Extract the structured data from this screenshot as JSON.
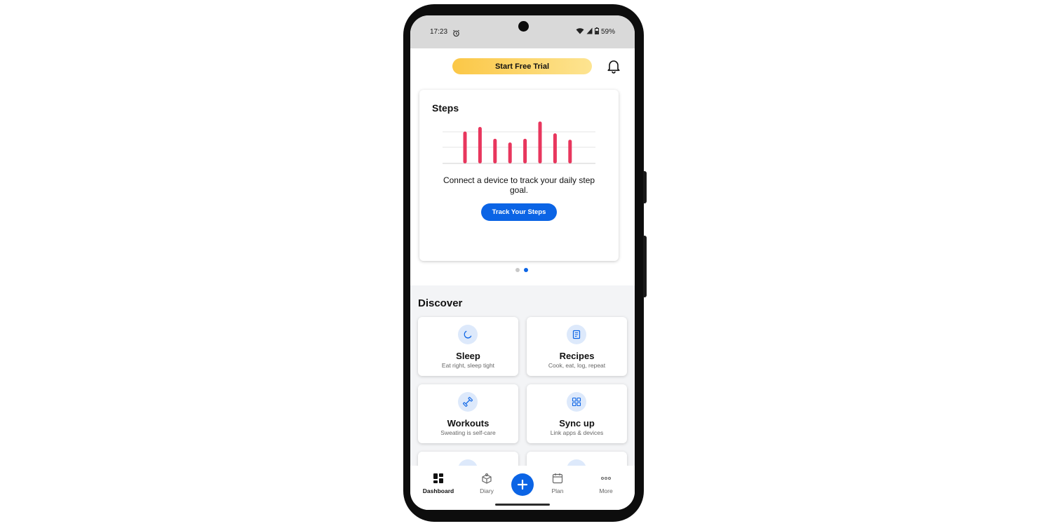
{
  "status": {
    "time": "17:23",
    "battery": "59%"
  },
  "topbar": {
    "trial_label": "Start Free Trial"
  },
  "steps_card": {
    "title": "Steps",
    "message": "Connect a device to track your daily step goal.",
    "button_label": "Track Your Steps",
    "bar_levels": [
      0.7,
      0.8,
      0.54,
      0.46,
      0.54,
      0.92,
      0.66,
      0.52
    ],
    "bar_color": "#e8365d"
  },
  "carousel": {
    "count": 2,
    "active_index": 1
  },
  "discover": {
    "title": "Discover",
    "tiles": [
      {
        "title": "Sleep",
        "subtitle": "Eat right, sleep tight",
        "icon": "moon-icon"
      },
      {
        "title": "Recipes",
        "subtitle": "Cook, eat, log, repeat",
        "icon": "recipe-icon"
      },
      {
        "title": "Workouts",
        "subtitle": "Sweating is self-care",
        "icon": "dumbbell-icon"
      },
      {
        "title": "Sync up",
        "subtitle": "Link apps & devices",
        "icon": "grid-icon"
      }
    ]
  },
  "nav": {
    "dashboard": "Dashboard",
    "diary": "Diary",
    "plan": "Plan",
    "more": "More"
  },
  "colors": {
    "accent": "#0b64e5",
    "trial_start": "#fbc746",
    "trial_end": "#fde491",
    "discover_bg": "#f3f4f6"
  }
}
